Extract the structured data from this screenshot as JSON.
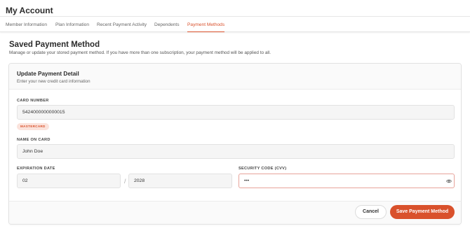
{
  "header": {
    "title": "My Account"
  },
  "tabs": [
    {
      "label": "Member Information",
      "active": false
    },
    {
      "label": "Plan Information",
      "active": false
    },
    {
      "label": "Recent Payment Activity",
      "active": false
    },
    {
      "label": "Dependents",
      "active": false
    },
    {
      "label": "Payment Methods",
      "active": true
    }
  ],
  "section": {
    "title": "Saved Payment Method",
    "description": "Manage or update your stored payment method. If you have more than one subscription, your payment method will be applied to all."
  },
  "form": {
    "title": "Update Payment Detail",
    "subtitle": "Enter your new credit card information",
    "card_number_label": "CARD NUMBER",
    "card_number_value": "5424000000000015",
    "card_brand": "MASTERCARD",
    "name_label": "NAME ON CARD",
    "name_value": "John Doe",
    "expiration_label": "EXPIRATION DATE",
    "exp_month": "02",
    "exp_separator": "/",
    "exp_year": "2028",
    "cvv_label": "SECURITY CODE (CVV)",
    "cvv_value": "•••",
    "cvv_toggle_icon": "eye-icon"
  },
  "actions": {
    "cancel_label": "Cancel",
    "save_label": "Save Payment Method"
  },
  "colors": {
    "accent": "#d9512c",
    "badge_bg": "#fbe3dc",
    "field_bg": "#f5f5f5"
  }
}
